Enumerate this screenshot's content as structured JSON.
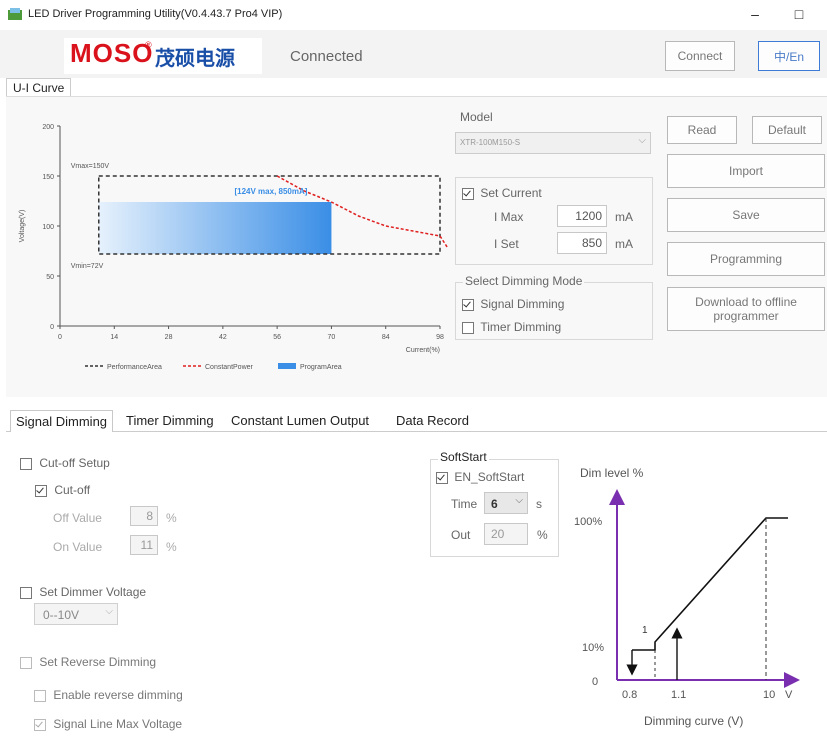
{
  "window": {
    "title": "LED Driver Programming Utility(V0.4.43.7 Pro4 VIP)",
    "minimize": "–",
    "maximize": "□"
  },
  "header": {
    "logo_text": "MOSO",
    "logo_reg": "®",
    "logo_cn": "茂硕电源",
    "status": "Connected",
    "connect_label": "Connect",
    "lang_label": "中/En"
  },
  "main_tab": "U-I Curve",
  "chart_data": {
    "type": "line",
    "y_ticks": [
      "200",
      "150",
      "100",
      "50",
      "0"
    ],
    "x_ticks": [
      "0",
      "14",
      "28",
      "42",
      "56",
      "70",
      "84",
      "98"
    ],
    "ylabel": "Voltage(V)",
    "xlabel": "Current(%)",
    "ylim": [
      0,
      200
    ],
    "xlim": [
      0,
      98
    ],
    "annotations": {
      "vmax": "Vmax=150V",
      "vmin": "Vmin=72V",
      "point": "[124V max, 850mA]"
    },
    "legend": [
      "PerformanceArea",
      "ConstantPower",
      "ProgramArea"
    ],
    "series": [
      {
        "name": "PerformanceArea",
        "points": [
          [
            10,
            150
          ],
          [
            98,
            150
          ],
          [
            98,
            72
          ],
          [
            10,
            72
          ],
          [
            10,
            150
          ]
        ]
      },
      {
        "name": "ConstantPower",
        "points": [
          [
            56,
            150
          ],
          [
            63,
            135
          ],
          [
            70,
            124
          ],
          [
            77,
            110
          ],
          [
            84,
            100
          ],
          [
            91,
            95
          ],
          [
            98,
            90
          ],
          [
            100,
            78
          ]
        ]
      },
      {
        "name": "ProgramArea",
        "box": [
          10,
          72,
          70,
          124
        ]
      }
    ],
    "colors": {
      "performance": "#333333",
      "constant": "#e02020",
      "program": "#3a8ee6"
    }
  },
  "model": {
    "label": "Model",
    "value": "XTR-100M150-S"
  },
  "set_current": {
    "label": "Set Current",
    "imax_label": "I Max",
    "imax_value": "1200",
    "iset_label": "I Set",
    "iset_value": "850",
    "unit": "mA"
  },
  "dimming_mode": {
    "label": "Select Dimming Mode",
    "signal": "Signal Dimming",
    "timer": "Timer Dimming"
  },
  "actions": {
    "read": "Read",
    "default": "Default",
    "import": "Import",
    "save": "Save",
    "programming": "Programming",
    "download_line1": "Download to offline",
    "download_line2": "programmer"
  },
  "sub_tabs": [
    "Signal Dimming",
    "Timer Dimming",
    "Constant Lumen Output",
    "Data Record"
  ],
  "signal": {
    "cutoff_setup": "Cut-off Setup",
    "cutoff": "Cut-off",
    "off_value_label": "Off Value",
    "off_value": "8",
    "on_value_label": "On Value",
    "on_value": "11",
    "percent": "%",
    "set_dimmer_voltage": "Set Dimmer Voltage",
    "dimmer_voltage_value": "0--10V",
    "set_reverse": "Set Reverse Dimming",
    "enable_reverse": "Enable reverse dimming",
    "signal_line_max": "Signal Line Max Voltage"
  },
  "softstart": {
    "title": "SoftStart",
    "enable": "EN_SoftStart",
    "time_label": "Time",
    "time_value": "6",
    "time_unit": "s",
    "out_label": "Out",
    "out_value": "20",
    "out_unit": "%"
  },
  "dim_curve": {
    "title": "Dim level %",
    "y100": "100%",
    "y10": "10%",
    "y0": "0",
    "x08": "0.8",
    "x11": "1.1",
    "x10": "10",
    "xv": "V",
    "label1": "1",
    "caption": "Dimming curve (V)"
  }
}
